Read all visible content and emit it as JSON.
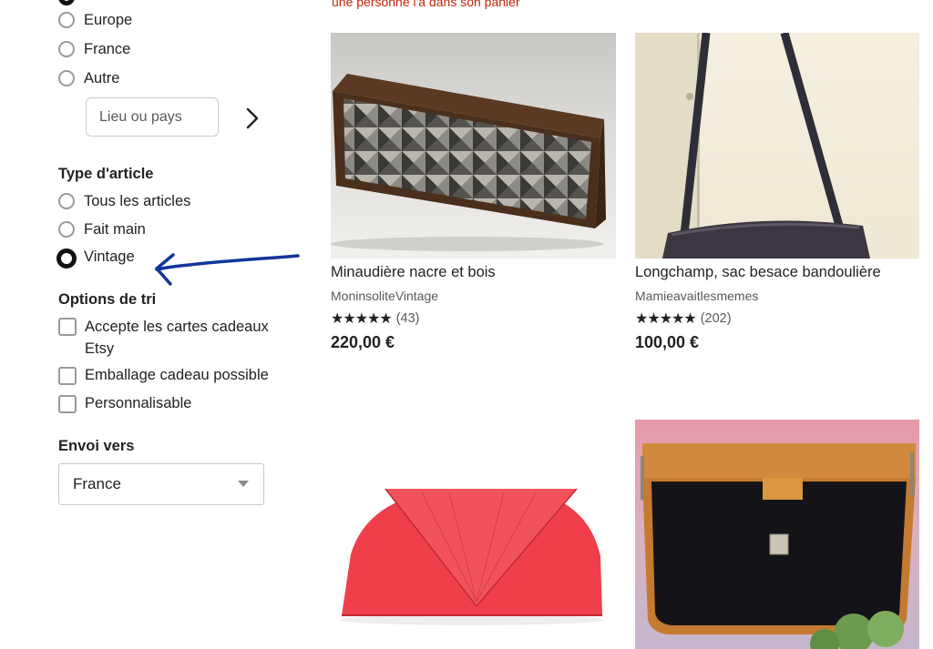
{
  "top_banner": "une personne l'a dans son panier",
  "location_filter": {
    "options": [
      {
        "label": "Europe",
        "checked": false
      },
      {
        "label": "France",
        "checked": false
      },
      {
        "label": "Autre",
        "checked": false
      }
    ],
    "placeholder": "Lieu ou pays"
  },
  "item_type": {
    "title": "Type d'article",
    "options": [
      {
        "label": "Tous les articles",
        "checked": false
      },
      {
        "label": "Fait main",
        "checked": false
      },
      {
        "label": "Vintage",
        "checked": true
      }
    ]
  },
  "sort_options": {
    "title": "Options de tri",
    "options": [
      {
        "label": "Accepte les cartes cadeaux Etsy",
        "checked": false
      },
      {
        "label": "Emballage cadeau possible",
        "checked": false
      },
      {
        "label": "Personnalisable",
        "checked": false
      }
    ]
  },
  "ship_to": {
    "title": "Envoi vers",
    "selected": "France"
  },
  "products": [
    {
      "title": "Minaudière nacre et bois",
      "shop": "MoninsoliteVintage",
      "stars": "★★★★★",
      "reviews": "(43)",
      "price": "220,00 €"
    },
    {
      "title": "Longchamp, sac besace bandoulière",
      "shop": "Mamieavaitlesmemes",
      "stars": "★★★★★",
      "reviews": "(202)",
      "price": "100,00 €"
    }
  ],
  "colors": {
    "accent_red": "#c2260a",
    "annotation_blue": "#12359c"
  }
}
